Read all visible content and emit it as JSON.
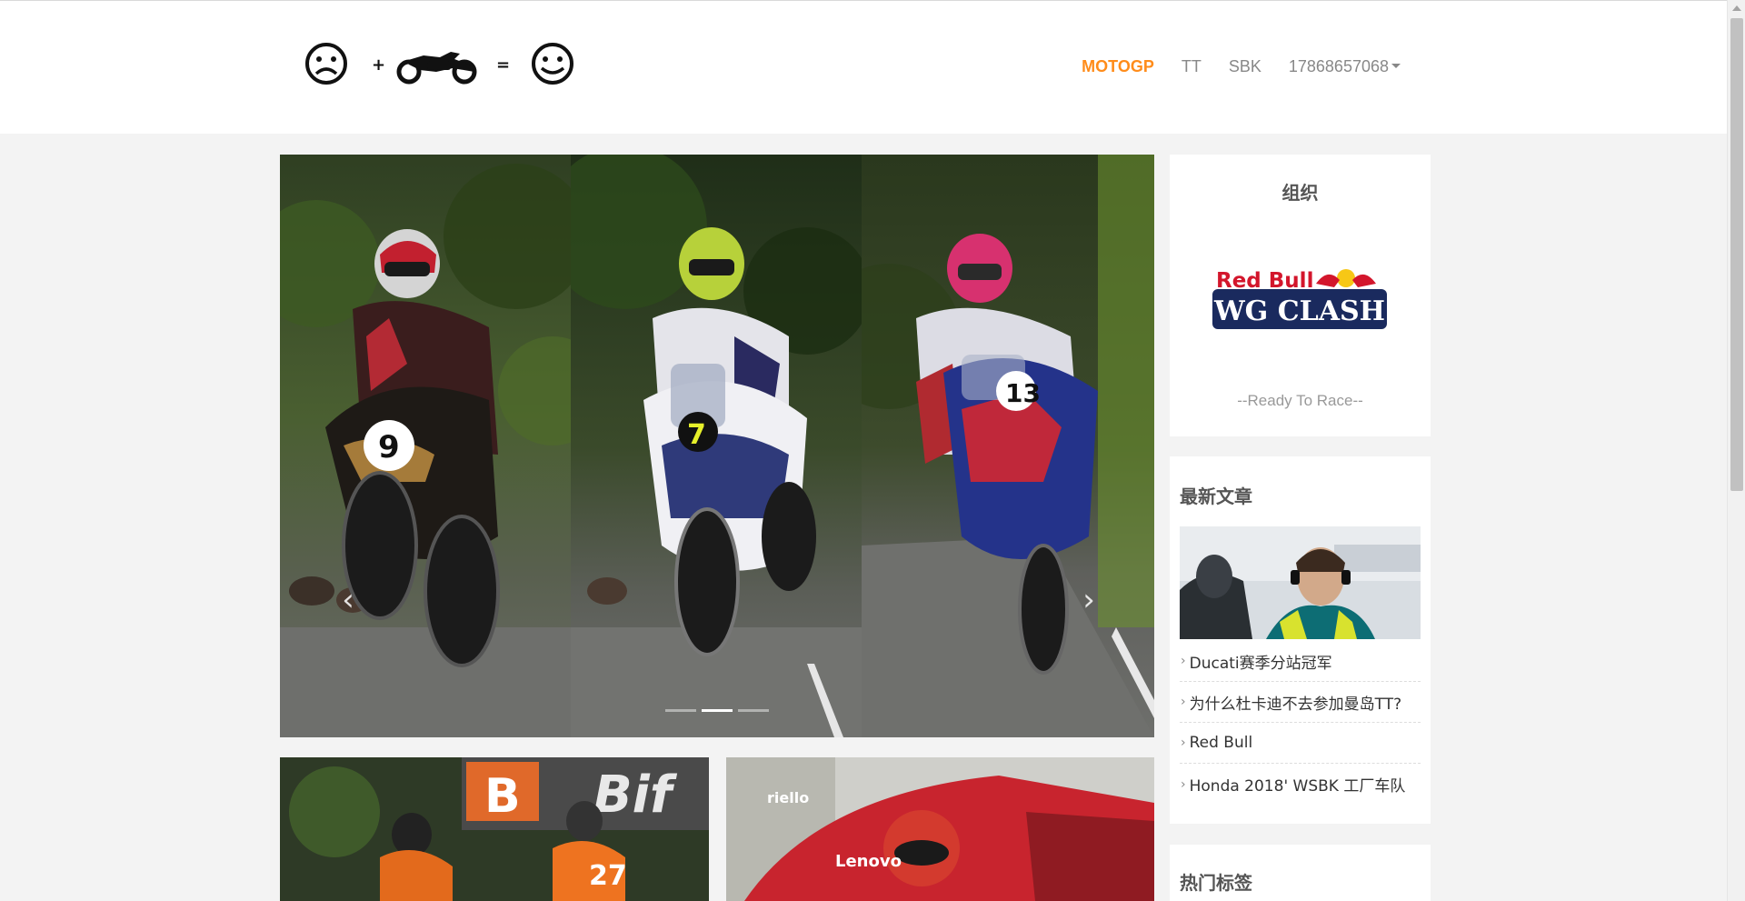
{
  "header": {
    "logo_alt": "sad face + motorcycle = happy face",
    "nav": [
      {
        "label": "MOTOGP",
        "active": true
      },
      {
        "label": "TT",
        "active": false
      },
      {
        "label": "SBK",
        "active": false
      },
      {
        "label": "17868657068",
        "active": false,
        "dropdown": true
      }
    ]
  },
  "carousel": {
    "prev_icon": "chevron-left-icon",
    "next_icon": "chevron-right-icon",
    "indicators": 3,
    "active_indicator": 1
  },
  "sidebar": {
    "org": {
      "title": "组织",
      "logo_text_top": "Red Bull",
      "logo_text_bottom": "WG CLASH",
      "slogan": "--Ready To Race--"
    },
    "latest": {
      "title": "最新文章",
      "items": [
        {
          "label": "Ducati赛季分站冠军"
        },
        {
          "label": "为什么杜卡迪不去参加曼岛TT?"
        },
        {
          "label": "Red Bull"
        },
        {
          "label": "Honda 2018' WSBK 工厂车队"
        }
      ]
    },
    "tags": {
      "title": "热门标签"
    }
  },
  "colors": {
    "accent": "#ff8c1a",
    "nav_inactive": "#888888",
    "background": "#f3f3f3",
    "redbull_blue": "#1a2a5e",
    "redbull_red": "#d3162c",
    "redbull_yellow": "#f7c716"
  }
}
